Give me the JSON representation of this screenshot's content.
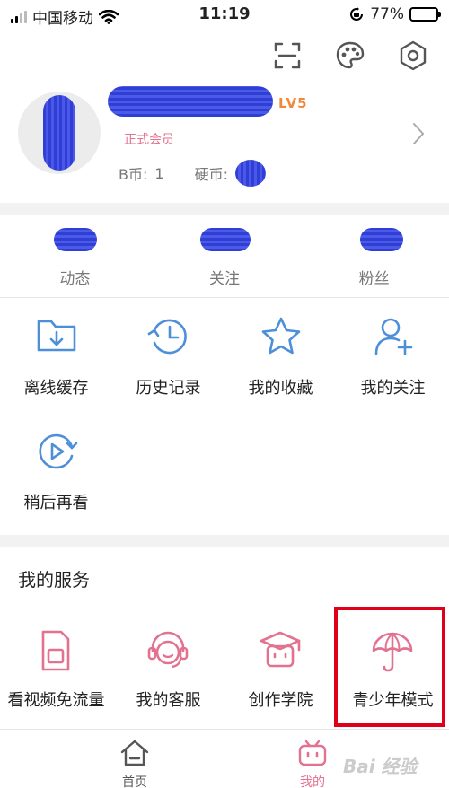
{
  "status_bar": {
    "carrier": "中国移动",
    "time": "11:19",
    "battery": "77%",
    "battery_level": 0.77
  },
  "top_icons": [
    "scan-icon",
    "palette-icon",
    "settings-icon"
  ],
  "profile": {
    "level": "LV5",
    "member_status": "正式会员",
    "b_coins_label": "B币:",
    "b_coins_value": "1",
    "coins_label": "硬币:"
  },
  "stats": [
    {
      "label": "动态"
    },
    {
      "label": "关注"
    },
    {
      "label": "粉丝"
    }
  ],
  "features": [
    {
      "label": "离线缓存",
      "icon": "offline-cache-icon"
    },
    {
      "label": "历史记录",
      "icon": "history-icon"
    },
    {
      "label": "我的收藏",
      "icon": "favorites-star-icon"
    },
    {
      "label": "我的关注",
      "icon": "follow-user-icon"
    },
    {
      "label": "稍后再看",
      "icon": "watch-later-icon"
    }
  ],
  "services": {
    "title": "我的服务",
    "items": [
      {
        "label": "看视频免流量",
        "icon": "sim-card-icon"
      },
      {
        "label": "我的客服",
        "icon": "customer-service-icon"
      },
      {
        "label": "创作学院",
        "icon": "creator-academy-icon"
      },
      {
        "label": "青少年模式",
        "icon": "umbrella-icon"
      }
    ]
  },
  "tabbar": [
    {
      "label": "首页",
      "icon": "home-icon"
    },
    {
      "label": "我的",
      "icon": "bilibili-tv-icon"
    }
  ],
  "colors": {
    "accent_blue": "#4d8fd8",
    "accent_pink": "#e2728f",
    "level_orange": "#f08a3a",
    "highlight_red": "#e0001b"
  },
  "watermark": "Bai 经验"
}
